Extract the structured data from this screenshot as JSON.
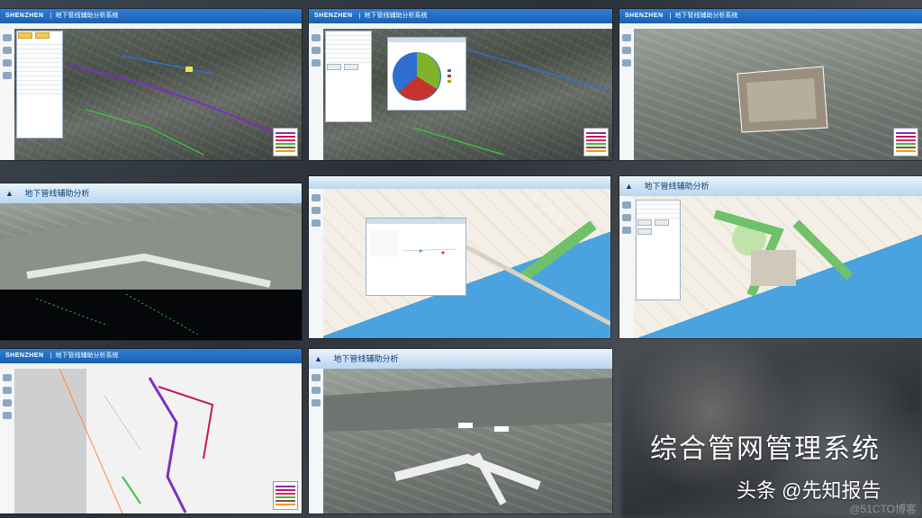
{
  "header": {
    "brand": "SHENZHEN",
    "system_title": "地下管线辅助分析系统",
    "system_title_alt": "地下管线辅助分析"
  },
  "caption": {
    "main": "综合管网管理系统",
    "author": "头条 @先知报告"
  },
  "watermark": "@51CTO博客",
  "colors": {
    "header_blue": "#1b5fb0",
    "pipe_purple": "#7b2fbf",
    "pipe_green": "#3bbf3b",
    "water_blue": "#4aa3df",
    "pie_blue": "#2f6fd1",
    "pie_red": "#c8322d",
    "pie_green": "#7fb42a"
  },
  "icons": [
    "brand-bird-icon",
    "nav-icon",
    "legend-icon",
    "chart-pie-icon"
  ]
}
